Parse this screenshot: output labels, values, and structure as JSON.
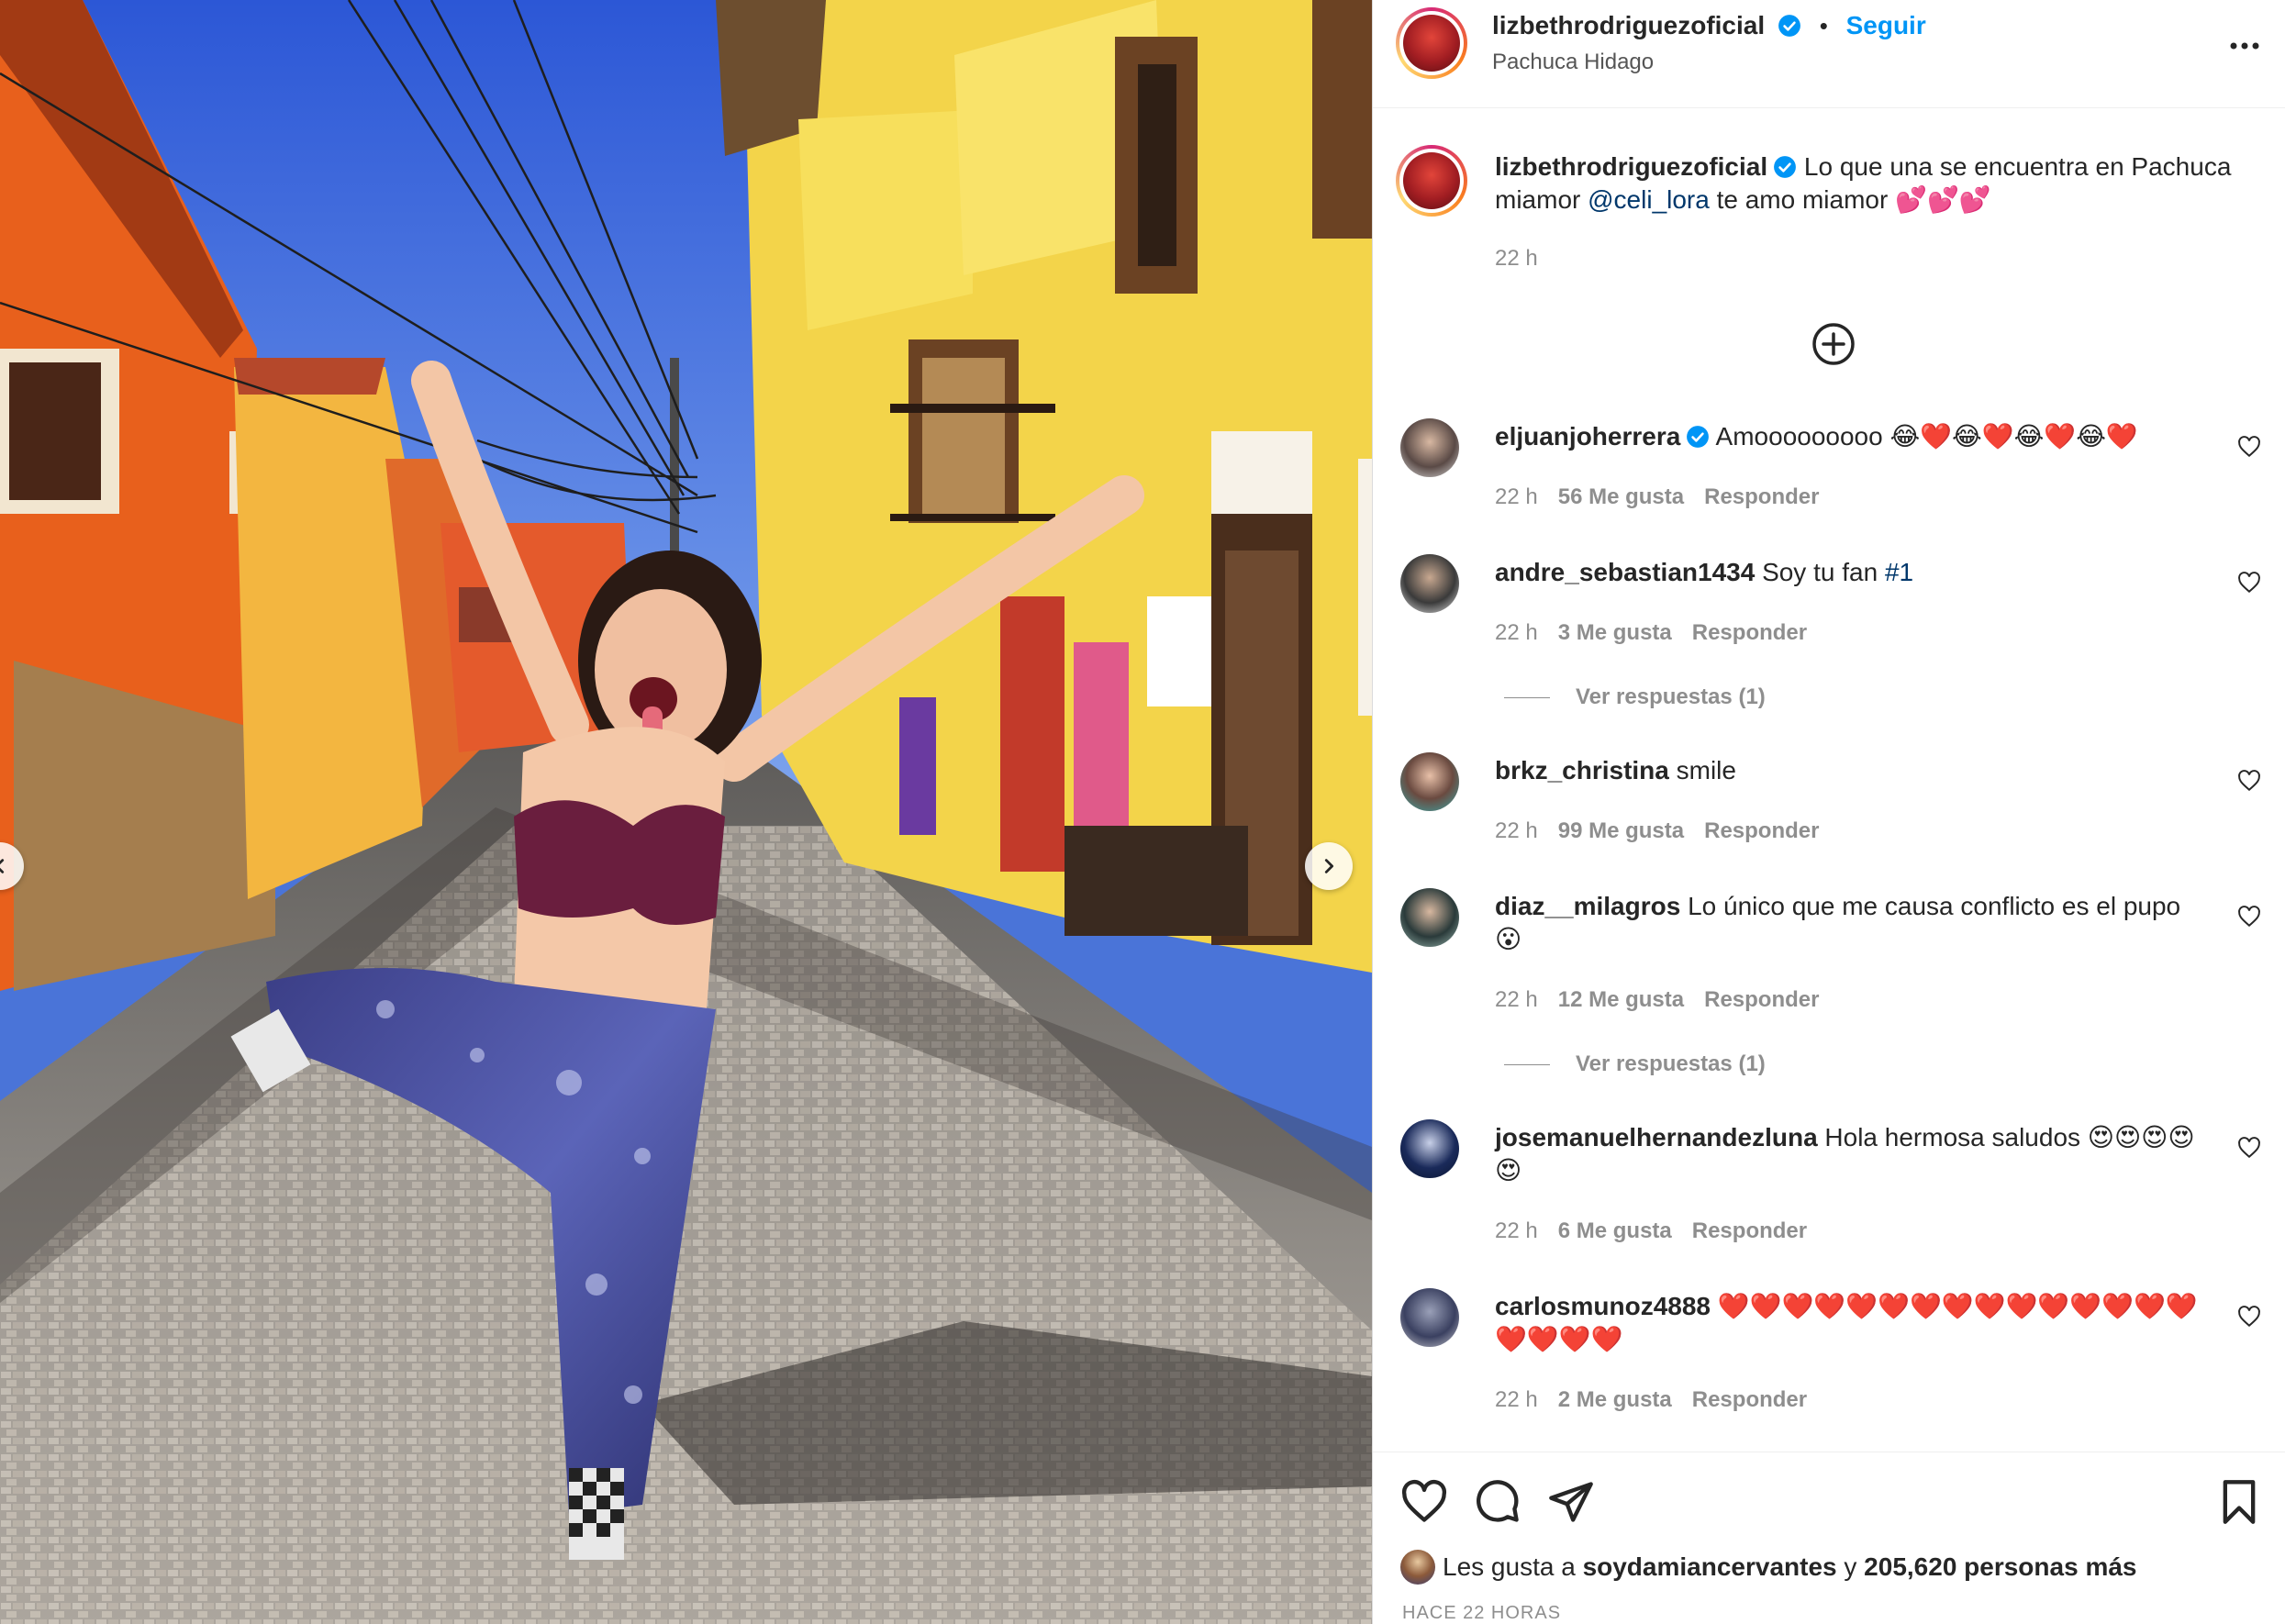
{
  "header": {
    "username": "lizbethrodriguezoficial",
    "separator": "•",
    "follow_label": "Seguir",
    "location": "Pachuca Hidago"
  },
  "caption": {
    "username": "lizbethrodriguezoficial",
    "text_before_mention": " Lo que una se encuentra en Pachuca miamor ",
    "mention": "@celi_lora",
    "text_after_mention": " te amo miamor 💕💕💕",
    "time": "22 h"
  },
  "comments": [
    {
      "username": "eljuanjoherrera",
      "verified": true,
      "text": "Amooooooooo 😂❤️😂❤️😂❤️😂❤️",
      "time": "22 h",
      "likes": "56 Me gusta",
      "reply": "Responder",
      "replies": ""
    },
    {
      "username": "andre_sebastian1434",
      "verified": false,
      "text": "Soy tu fan ",
      "hashtag": "#1",
      "time": "22 h",
      "likes": "3 Me gusta",
      "reply": "Responder",
      "replies": "Ver respuestas (1)"
    },
    {
      "username": "brkz_christina",
      "verified": false,
      "text": "smile",
      "time": "22 h",
      "likes": "99 Me gusta",
      "reply": "Responder",
      "replies": ""
    },
    {
      "username": "diaz__milagros",
      "verified": false,
      "text": "Lo único que me causa conflicto es el pupo 😮",
      "time": "22 h",
      "likes": "12 Me gusta",
      "reply": "Responder",
      "replies": "Ver respuestas (1)"
    },
    {
      "username": "josemanuelhernandezluna",
      "verified": false,
      "text": "Hola hermosa saludos 😍😍😍😍😍",
      "time": "22 h",
      "likes": "6 Me gusta",
      "reply": "Responder",
      "replies": ""
    },
    {
      "username": "carlosmunoz4888",
      "verified": false,
      "text": "❤️❤️❤️❤️❤️❤️❤️❤️❤️❤️❤️❤️❤️❤️❤️❤️❤️❤️❤️",
      "time": "22 h",
      "likes": "2 Me gusta",
      "reply": "Responder",
      "replies": ""
    }
  ],
  "footer": {
    "likes_prefix": "Les gusta a ",
    "likes_user": "soydamiancervantes",
    "likes_conj": " y ",
    "likes_count": "205,620 personas más",
    "date": "HACE 22 HORAS"
  },
  "icons": {
    "more": "more-options-icon",
    "add": "add-circle-icon",
    "like": "heart-icon",
    "comment": "comment-icon",
    "share": "send-icon",
    "save": "bookmark-icon",
    "prev": "chevron-left-icon",
    "next": "chevron-right-icon"
  },
  "colors": {
    "link": "#0095f6",
    "mention": "#00376b",
    "muted": "#8e8e8e",
    "verified": "#0095f6"
  }
}
